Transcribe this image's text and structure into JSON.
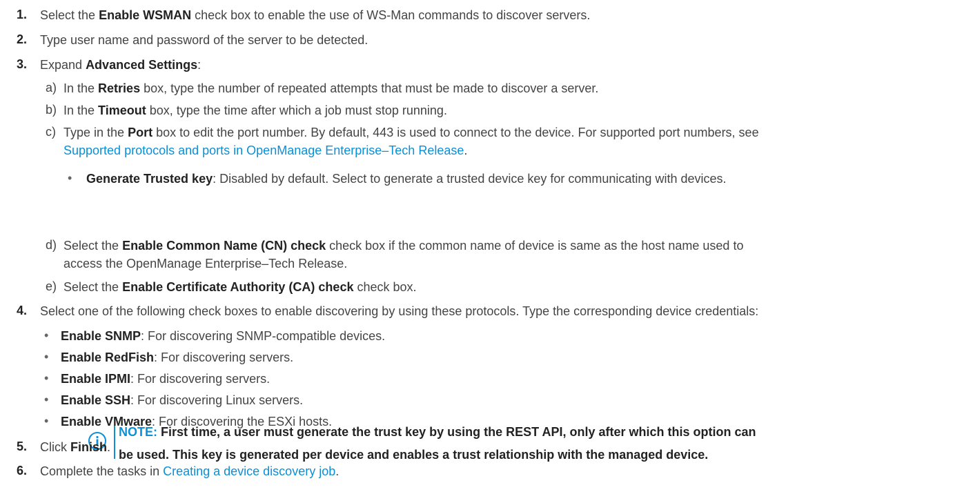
{
  "steps": {
    "s1": {
      "num": "1.",
      "pre": "Select the ",
      "bold": "Enable WSMAN",
      "post": " check box to enable the use of WS-Man commands to discover servers."
    },
    "s2": {
      "num": "2.",
      "text": "Type user name and password of the server to be detected."
    },
    "s3": {
      "num": "3.",
      "pre": "Expand ",
      "bold": "Advanced Settings",
      "post": ":"
    },
    "s4": {
      "num": "4.",
      "text": "Select one of the following check boxes to enable discovering by using these protocols. Type the corresponding device credentials:"
    },
    "s5": {
      "num": "5.",
      "pre": "Click ",
      "bold": "Finish",
      "post": "."
    },
    "s6": {
      "num": "6.",
      "pre": "Complete the tasks in ",
      "link": "Creating a device discovery job",
      "post": "."
    }
  },
  "substeps": {
    "a": {
      "label": "a)",
      "pre": "In the ",
      "bold": "Retries",
      "post": " box, type the number of repeated attempts that must be made to discover a server."
    },
    "b": {
      "label": "b)",
      "pre": "In the ",
      "bold": "Timeout",
      "post": " box, type the time after which a job must stop running."
    },
    "c": {
      "label": "c)",
      "pre": "Type in the ",
      "bold": "Port",
      "post": " box to edit the port number. By default, 443 is used to connect to the device. For supported port numbers, see",
      "link": "Supported protocols and ports in OpenManage Enterprise–Tech Release",
      "link_post": "."
    },
    "d": {
      "label": "d)",
      "pre": "Select the ",
      "bold": "Enable Common Name (CN) check",
      "post": " check box if the common name of device is same as the host name used to",
      "line2": "access the OpenManage Enterprise–Tech Release."
    },
    "e": {
      "label": "e)",
      "pre": "Select the ",
      "bold": "Enable Certificate Authority (CA) check",
      "post": " check box."
    }
  },
  "trusted_key": {
    "bullet": "•",
    "bold": "Generate Trusted key",
    "post": ": Disabled by default. Select to generate a trusted device key for communicating with devices."
  },
  "note": {
    "icon": "info-icon",
    "label": "NOTE:",
    "line1": " First time, a user must generate the trust key by using the REST API, only after which this option can",
    "line2": "be used. This key is generated per device and enables a trust relationship with the managed device."
  },
  "protocols": [
    {
      "bold": "Enable SNMP",
      "post": ": For discovering SNMP-compatible devices."
    },
    {
      "bold": "Enable RedFish",
      "post": ": For discovering servers."
    },
    {
      "bold": "Enable IPMI",
      "post": ": For discovering servers."
    },
    {
      "bold": "Enable SSH",
      "post": ": For discovering Linux servers."
    },
    {
      "bold": "Enable VMware",
      "post": ": For discovering the ESXi hosts."
    }
  ],
  "bullet_char": "•",
  "colors": {
    "link": "#0b8fd6",
    "text": "#444444",
    "bold": "#222222"
  }
}
